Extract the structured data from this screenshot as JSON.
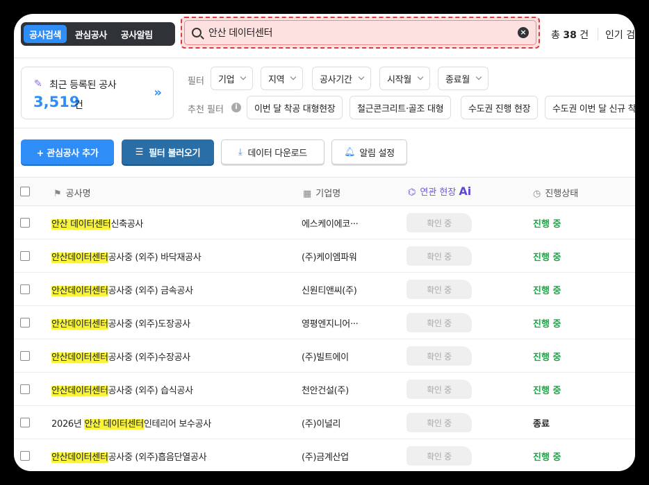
{
  "nav_tabs": [
    {
      "label": "공사검색",
      "active": true
    },
    {
      "label": "관심공사",
      "active": false
    },
    {
      "label": "공사알림",
      "active": false
    }
  ],
  "search": {
    "value": "안산 데이터센터",
    "clear_icon": "close-circle-icon"
  },
  "total": {
    "prefix": "총",
    "count": "38",
    "suffix": "건"
  },
  "popular_label": "인기 검",
  "recent_card": {
    "title": "최근 등록된 공사",
    "count": "3,519",
    "unit": "건"
  },
  "filters": {
    "label": "필터",
    "items": [
      "기업",
      "지역",
      "공사기간",
      "시작월",
      "종료월"
    ]
  },
  "recommended_filters": {
    "label": "추천 필터",
    "items": [
      "이번 달 착공 대형현장",
      "철근콘크리트·골조 대형",
      "수도권 진행 현장",
      "수도권 이번 달 신규 착"
    ]
  },
  "actions": {
    "add_interest": "+ 관심공사 추가",
    "load_filter": "필터 불러오기",
    "download": "데이터 다운로드",
    "alert": "알림 설정"
  },
  "table": {
    "headers": {
      "name": "공사명",
      "company": "기업명",
      "related": "연관 현장",
      "ai": "Ai",
      "status": "진행상태"
    },
    "rows": [
      {
        "pre": "",
        "hl": "안산 데이터센터",
        "post": "신축공사",
        "company": "에스케이에코···",
        "related": "확인 중",
        "status": "진행 중",
        "done": false
      },
      {
        "pre": "",
        "hl": "안산데이터센터",
        "post": "공사중 (외주) 바닥재공사",
        "company": "(주)케이엠파워",
        "related": "확인 중",
        "status": "진행 중",
        "done": false
      },
      {
        "pre": "",
        "hl": "안산데이터센터",
        "post": "공사중 (외주) 금속공사",
        "company": "신원티앤씨(주)",
        "related": "확인 중",
        "status": "진행 중",
        "done": false
      },
      {
        "pre": "",
        "hl": "안산데이터센터",
        "post": "공사중 (외주)도장공사",
        "company": "영평엔지니어···",
        "related": "확인 중",
        "status": "진행 중",
        "done": false
      },
      {
        "pre": "",
        "hl": "안산데이터센터",
        "post": "공사중 (외주)수장공사",
        "company": "(주)빌트에이",
        "related": "확인 중",
        "status": "진행 중",
        "done": false
      },
      {
        "pre": "",
        "hl": "안산데이터센터",
        "post": "공사중 (외주) 습식공사",
        "company": "천안건설(주)",
        "related": "확인 중",
        "status": "진행 중",
        "done": false
      },
      {
        "pre": "2026년 ",
        "hl": "안산 데이터센터",
        "post": "인테리어 보수공사",
        "company": "(주)이널리",
        "related": "확인 중",
        "status": "종료",
        "done": true
      },
      {
        "pre": "",
        "hl": "안산데이터센터",
        "post": "공사중 (외주)흡음단열공사",
        "company": "(주)금계산업",
        "related": "확인 중",
        "status": "진행 중",
        "done": false
      }
    ]
  },
  "colors": {
    "accent": "#2f8df7",
    "status_active": "#27a04a",
    "highlight": "#f7f23a",
    "search_bg": "#fde0e0"
  }
}
